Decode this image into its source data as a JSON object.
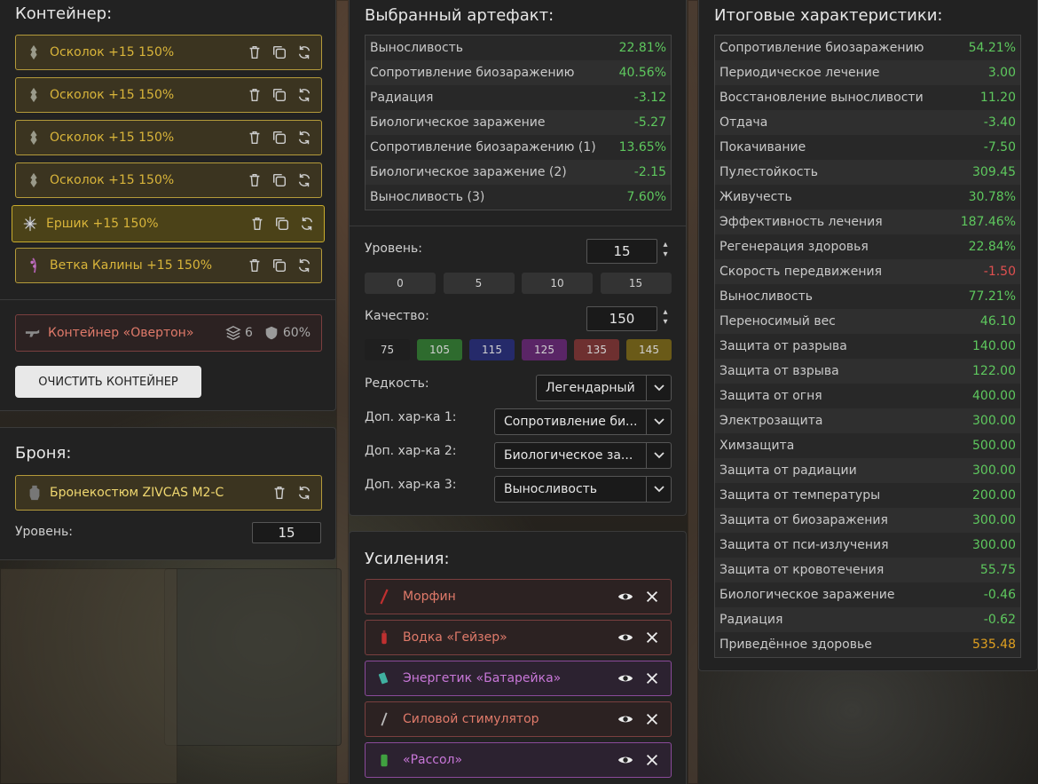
{
  "container": {
    "title": "Контейнер:",
    "slots": [
      {
        "label": "Осколок +15 150%"
      },
      {
        "label": "Осколок +15 150%"
      },
      {
        "label": "Осколок +15 150%"
      },
      {
        "label": "Осколок +15 150%"
      },
      {
        "label": "Ершик +15 150%"
      },
      {
        "label": "Ветка Калины +15 150%"
      }
    ],
    "item": {
      "name": "Контейнер «Овертон»",
      "slots_count": "6",
      "protection": "60%"
    },
    "clear_button": "ОЧИСТИТЬ КОНТЕЙНЕР"
  },
  "armor": {
    "title": "Броня:",
    "item_name": "Бронекостюм ZIVCAS M2-C",
    "level_label": "Уровень:",
    "level_value": "15"
  },
  "artifact": {
    "title": "Выбранный артефакт:",
    "stats": [
      {
        "name": "Выносливость",
        "value": "22.81%"
      },
      {
        "name": "Сопротивление биозаражению",
        "value": "40.56%"
      },
      {
        "name": "Радиация",
        "value": "-3.12"
      },
      {
        "name": "Биологическое заражение",
        "value": "-5.27"
      },
      {
        "name": "Сопротивление биозаражению (1)",
        "value": "13.65%"
      },
      {
        "name": "Биологическое заражение (2)",
        "value": "-2.15"
      },
      {
        "name": "Выносливость (3)",
        "value": "7.60%"
      }
    ],
    "level_label": "Уровень:",
    "level_value": "15",
    "level_presets": [
      "0",
      "5",
      "10",
      "15"
    ],
    "quality_label": "Качество:",
    "quality_value": "150",
    "quality_presets": [
      {
        "label": "75",
        "color": "#1f1f1f"
      },
      {
        "label": "105",
        "color": "#2e6b2e"
      },
      {
        "label": "115",
        "color": "#252a6a"
      },
      {
        "label": "125",
        "color": "#5a2566"
      },
      {
        "label": "135",
        "color": "#6e3030"
      },
      {
        "label": "145",
        "color": "#6a5a18"
      }
    ],
    "rarity_label": "Редкость:",
    "rarity_value": "Легендарный",
    "extra1_label": "Доп. хар-ка 1:",
    "extra1_value": "Сопротивление би...",
    "extra2_label": "Доп. хар-ка 2:",
    "extra2_value": "Биологическое за...",
    "extra3_label": "Доп. хар-ка 3:",
    "extra3_value": "Выносливость"
  },
  "boosts": {
    "title": "Усиления:",
    "items": [
      {
        "name": "Морфин",
        "style": "red"
      },
      {
        "name": "Водка «Гейзер»",
        "style": "red"
      },
      {
        "name": "Энергетик «Батарейка»",
        "style": "violet"
      },
      {
        "name": "Силовой стимулятор",
        "style": "red"
      },
      {
        "name": "«Рассол»",
        "style": "violet"
      }
    ]
  },
  "totals": {
    "title": "Итоговые характеристики:",
    "stats": [
      {
        "name": "Сопротивление биозаражению",
        "value": "54.21%",
        "tone": "green"
      },
      {
        "name": "Периодическое лечение",
        "value": "3.00",
        "tone": "green"
      },
      {
        "name": "Восстановление выносливости",
        "value": "11.20",
        "tone": "green"
      },
      {
        "name": "Отдача",
        "value": "-3.40",
        "tone": "green"
      },
      {
        "name": "Покачивание",
        "value": "-7.50",
        "tone": "green"
      },
      {
        "name": "Пулестойкость",
        "value": "309.45",
        "tone": "green"
      },
      {
        "name": "Живучесть",
        "value": "30.78%",
        "tone": "green"
      },
      {
        "name": "Эффективность лечения",
        "value": "187.46%",
        "tone": "green"
      },
      {
        "name": "Регенерация здоровья",
        "value": "22.84%",
        "tone": "green"
      },
      {
        "name": "Скорость передвижения",
        "value": "-1.50",
        "tone": "red"
      },
      {
        "name": "Выносливость",
        "value": "77.21%",
        "tone": "green"
      },
      {
        "name": "Переносимый вес",
        "value": "46.10",
        "tone": "green"
      },
      {
        "name": "Защита от разрыва",
        "value": "140.00",
        "tone": "green"
      },
      {
        "name": "Защита от взрыва",
        "value": "122.00",
        "tone": "green"
      },
      {
        "name": "Защита от огня",
        "value": "400.00",
        "tone": "green"
      },
      {
        "name": "Электрозащита",
        "value": "300.00",
        "tone": "green"
      },
      {
        "name": "Химзащита",
        "value": "500.00",
        "tone": "green"
      },
      {
        "name": "Защита от радиации",
        "value": "300.00",
        "tone": "green"
      },
      {
        "name": "Защита от температуры",
        "value": "200.00",
        "tone": "green"
      },
      {
        "name": "Защита от биозаражения",
        "value": "300.00",
        "tone": "green"
      },
      {
        "name": "Защита от пси-излучения",
        "value": "300.00",
        "tone": "green"
      },
      {
        "name": "Защита от кровотечения",
        "value": "55.75",
        "tone": "green"
      },
      {
        "name": "Биологическое заражение",
        "value": "-0.46",
        "tone": "green"
      },
      {
        "name": "Радиация",
        "value": "-0.62",
        "tone": "green"
      },
      {
        "name": "Приведённое здоровье",
        "value": "535.48",
        "tone": "gold"
      }
    ]
  }
}
